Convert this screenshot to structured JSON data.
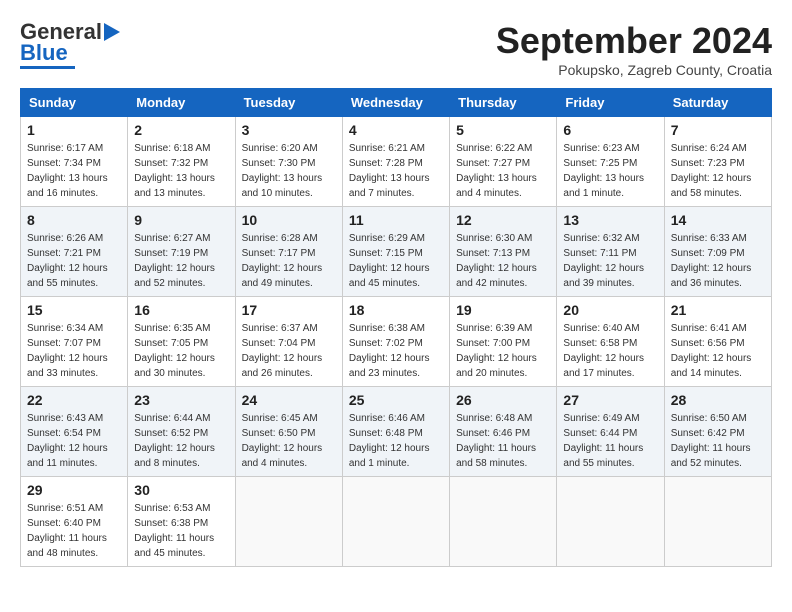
{
  "header": {
    "logo_line1": "General",
    "logo_line2": "Blue",
    "title": "September 2024",
    "subtitle": "Pokupsko, Zagreb County, Croatia"
  },
  "weekdays": [
    "Sunday",
    "Monday",
    "Tuesday",
    "Wednesday",
    "Thursday",
    "Friday",
    "Saturday"
  ],
  "weeks": [
    [
      {
        "day": 1,
        "info": "Sunrise: 6:17 AM\nSunset: 7:34 PM\nDaylight: 13 hours\nand 16 minutes."
      },
      {
        "day": 2,
        "info": "Sunrise: 6:18 AM\nSunset: 7:32 PM\nDaylight: 13 hours\nand 13 minutes."
      },
      {
        "day": 3,
        "info": "Sunrise: 6:20 AM\nSunset: 7:30 PM\nDaylight: 13 hours\nand 10 minutes."
      },
      {
        "day": 4,
        "info": "Sunrise: 6:21 AM\nSunset: 7:28 PM\nDaylight: 13 hours\nand 7 minutes."
      },
      {
        "day": 5,
        "info": "Sunrise: 6:22 AM\nSunset: 7:27 PM\nDaylight: 13 hours\nand 4 minutes."
      },
      {
        "day": 6,
        "info": "Sunrise: 6:23 AM\nSunset: 7:25 PM\nDaylight: 13 hours\nand 1 minute."
      },
      {
        "day": 7,
        "info": "Sunrise: 6:24 AM\nSunset: 7:23 PM\nDaylight: 12 hours\nand 58 minutes."
      }
    ],
    [
      {
        "day": 8,
        "info": "Sunrise: 6:26 AM\nSunset: 7:21 PM\nDaylight: 12 hours\nand 55 minutes."
      },
      {
        "day": 9,
        "info": "Sunrise: 6:27 AM\nSunset: 7:19 PM\nDaylight: 12 hours\nand 52 minutes."
      },
      {
        "day": 10,
        "info": "Sunrise: 6:28 AM\nSunset: 7:17 PM\nDaylight: 12 hours\nand 49 minutes."
      },
      {
        "day": 11,
        "info": "Sunrise: 6:29 AM\nSunset: 7:15 PM\nDaylight: 12 hours\nand 45 minutes."
      },
      {
        "day": 12,
        "info": "Sunrise: 6:30 AM\nSunset: 7:13 PM\nDaylight: 12 hours\nand 42 minutes."
      },
      {
        "day": 13,
        "info": "Sunrise: 6:32 AM\nSunset: 7:11 PM\nDaylight: 12 hours\nand 39 minutes."
      },
      {
        "day": 14,
        "info": "Sunrise: 6:33 AM\nSunset: 7:09 PM\nDaylight: 12 hours\nand 36 minutes."
      }
    ],
    [
      {
        "day": 15,
        "info": "Sunrise: 6:34 AM\nSunset: 7:07 PM\nDaylight: 12 hours\nand 33 minutes."
      },
      {
        "day": 16,
        "info": "Sunrise: 6:35 AM\nSunset: 7:05 PM\nDaylight: 12 hours\nand 30 minutes."
      },
      {
        "day": 17,
        "info": "Sunrise: 6:37 AM\nSunset: 7:04 PM\nDaylight: 12 hours\nand 26 minutes."
      },
      {
        "day": 18,
        "info": "Sunrise: 6:38 AM\nSunset: 7:02 PM\nDaylight: 12 hours\nand 23 minutes."
      },
      {
        "day": 19,
        "info": "Sunrise: 6:39 AM\nSunset: 7:00 PM\nDaylight: 12 hours\nand 20 minutes."
      },
      {
        "day": 20,
        "info": "Sunrise: 6:40 AM\nSunset: 6:58 PM\nDaylight: 12 hours\nand 17 minutes."
      },
      {
        "day": 21,
        "info": "Sunrise: 6:41 AM\nSunset: 6:56 PM\nDaylight: 12 hours\nand 14 minutes."
      }
    ],
    [
      {
        "day": 22,
        "info": "Sunrise: 6:43 AM\nSunset: 6:54 PM\nDaylight: 12 hours\nand 11 minutes."
      },
      {
        "day": 23,
        "info": "Sunrise: 6:44 AM\nSunset: 6:52 PM\nDaylight: 12 hours\nand 8 minutes."
      },
      {
        "day": 24,
        "info": "Sunrise: 6:45 AM\nSunset: 6:50 PM\nDaylight: 12 hours\nand 4 minutes."
      },
      {
        "day": 25,
        "info": "Sunrise: 6:46 AM\nSunset: 6:48 PM\nDaylight: 12 hours\nand 1 minute."
      },
      {
        "day": 26,
        "info": "Sunrise: 6:48 AM\nSunset: 6:46 PM\nDaylight: 11 hours\nand 58 minutes."
      },
      {
        "day": 27,
        "info": "Sunrise: 6:49 AM\nSunset: 6:44 PM\nDaylight: 11 hours\nand 55 minutes."
      },
      {
        "day": 28,
        "info": "Sunrise: 6:50 AM\nSunset: 6:42 PM\nDaylight: 11 hours\nand 52 minutes."
      }
    ],
    [
      {
        "day": 29,
        "info": "Sunrise: 6:51 AM\nSunset: 6:40 PM\nDaylight: 11 hours\nand 48 minutes."
      },
      {
        "day": 30,
        "info": "Sunrise: 6:53 AM\nSunset: 6:38 PM\nDaylight: 11 hours\nand 45 minutes."
      },
      {
        "day": null,
        "info": ""
      },
      {
        "day": null,
        "info": ""
      },
      {
        "day": null,
        "info": ""
      },
      {
        "day": null,
        "info": ""
      },
      {
        "day": null,
        "info": ""
      }
    ]
  ]
}
